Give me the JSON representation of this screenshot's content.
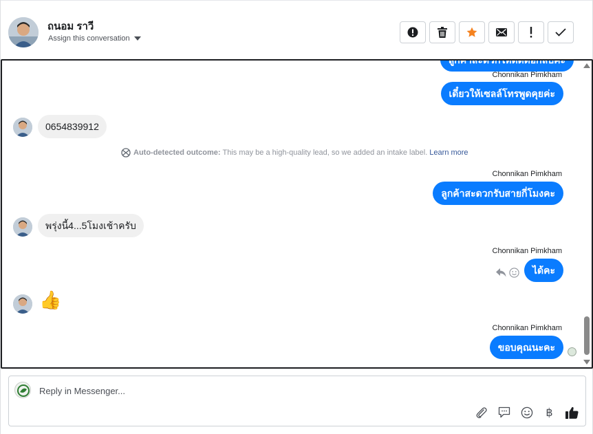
{
  "header": {
    "contact_name": "ถนอม ราวี",
    "assign_label": "Assign this conversation",
    "actions": [
      "alert-icon",
      "trash-icon",
      "star-icon",
      "mail-icon",
      "exclamation-icon",
      "check-icon"
    ]
  },
  "conversation": {
    "messages": [
      {
        "from": "page",
        "sender": "",
        "text": "ลูกค้าสะดวกให้ติดต่อกลับค่ะ"
      },
      {
        "from": "page",
        "sender": "Chonnikan Pimkham",
        "text": "เดี๋ยวให้เซลล์โทรพูดคุยค่ะ"
      },
      {
        "from": "customer",
        "text": "0654839912"
      },
      {
        "from": "page",
        "sender": "Chonnikan Pimkham",
        "text": "ลูกค้าสะดวกรับสายกี่โมงคะ"
      },
      {
        "from": "customer",
        "text": "พรุ่งนี้4...5โมงเช้าครับ"
      },
      {
        "from": "page",
        "sender": "Chonnikan Pimkham",
        "text": "ได้คะ"
      },
      {
        "from": "customer",
        "text": "👍"
      },
      {
        "from": "page",
        "sender": "Chonnikan Pimkham",
        "text": "ขอบคุณนะคะ"
      }
    ],
    "notice": {
      "bold": "Auto-detected outcome:",
      "text": "This may be a high-quality lead, so we added an intake label.",
      "link": "Learn more"
    }
  },
  "composer": {
    "placeholder": "Reply in Messenger...",
    "tools": [
      "attach-icon",
      "saved-reply-icon",
      "emoji-icon",
      "baht-icon",
      "like-icon"
    ],
    "baht_symbol": "฿"
  },
  "colors": {
    "accent": "#0a7cff",
    "star": "#f5821f",
    "incoming_bubble": "#f0f0f0"
  }
}
